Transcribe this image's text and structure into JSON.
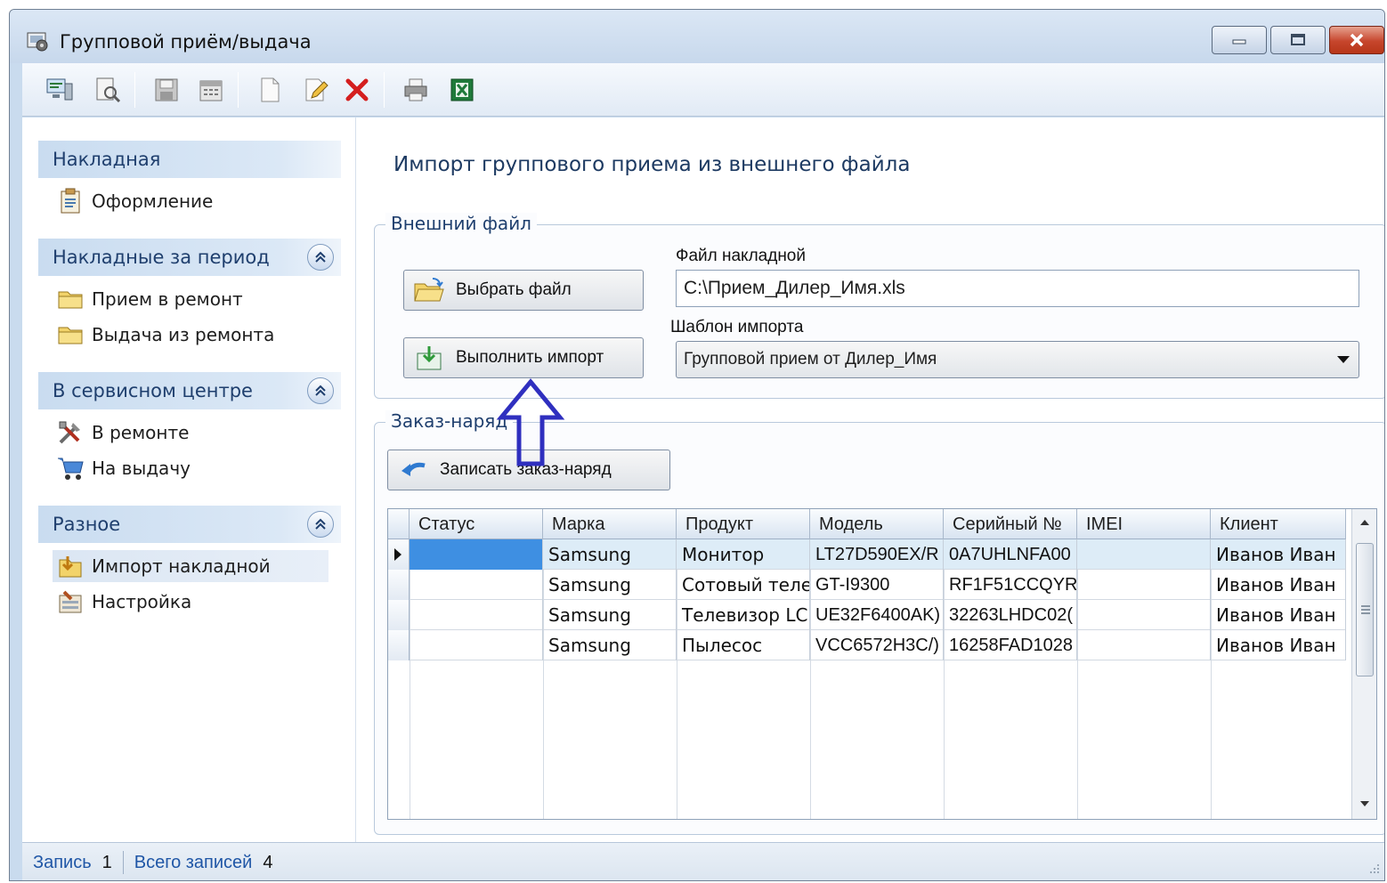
{
  "window": {
    "title": "Групповой приём/выдача"
  },
  "toolbar": {
    "buttons": [
      "computer-icon",
      "preview-icon",
      "save-icon",
      "calendar-icon",
      "new-document-icon",
      "edit-icon",
      "delete-icon",
      "print-icon",
      "excel-icon"
    ]
  },
  "sidebar": {
    "groups": [
      {
        "header": "Накладная",
        "items": [
          {
            "label": "Оформление",
            "icon": "clipboard-icon"
          }
        ]
      },
      {
        "header": "Накладные за период",
        "items": [
          {
            "label": "Прием в ремонт",
            "icon": "folder-icon"
          },
          {
            "label": "Выдача из ремонта",
            "icon": "folder-icon"
          }
        ]
      },
      {
        "header": "В сервисном центре",
        "items": [
          {
            "label": "В ремонте",
            "icon": "tools-icon"
          },
          {
            "label": "На выдачу",
            "icon": "cart-icon"
          }
        ]
      },
      {
        "header": "Разное",
        "items": [
          {
            "label": "Импорт накладной",
            "icon": "import-icon"
          },
          {
            "label": "Настройка",
            "icon": "settings-icon"
          }
        ]
      }
    ]
  },
  "main": {
    "title": "Импорт группового приема из внешнего файла",
    "external_file": {
      "legend": "Внешний файл",
      "choose_button": "Выбрать файл",
      "import_button": "Выполнить импорт",
      "file_label": "Файл накладной",
      "file_value": "C:\\Прием_Дилер_Имя.xls",
      "template_label": "Шаблон импорта",
      "template_value": "Групповой прием от Дилер_Имя"
    },
    "order": {
      "legend": "Заказ-наряд",
      "save_button": "Записать заказ-наряд"
    },
    "grid": {
      "columns": [
        "Статус",
        "Марка",
        "Продукт",
        "Модель",
        "Серийный №",
        "IMEI",
        "Клиент"
      ],
      "rows": [
        [
          "",
          "Samsung",
          "Монитор",
          "LT27D590EX/R",
          "0A7UHLNFA00",
          "",
          "Иванов Иван"
        ],
        [
          "",
          "Samsung",
          "Сотовый теле",
          "GT-I9300",
          "RF1F51CCQYR",
          "",
          "Иванов Иван"
        ],
        [
          "",
          "Samsung",
          "Телевизор LC",
          "UE32F6400AK)",
          "32263LHDC02(",
          "",
          "Иванов Иван"
        ],
        [
          "",
          "Samsung",
          "Пылесос",
          "VCC6572H3C/)",
          "16258FAD1028",
          "",
          "Иванов Иван"
        ]
      ]
    }
  },
  "statusbar": {
    "record_label": "Запись",
    "record_value": "1",
    "total_label": "Всего записей",
    "total_value": "4"
  },
  "colors": {
    "accent": "#1f3f6e",
    "selection": "#3e8fe2",
    "annotation": "#2f2fbf"
  }
}
